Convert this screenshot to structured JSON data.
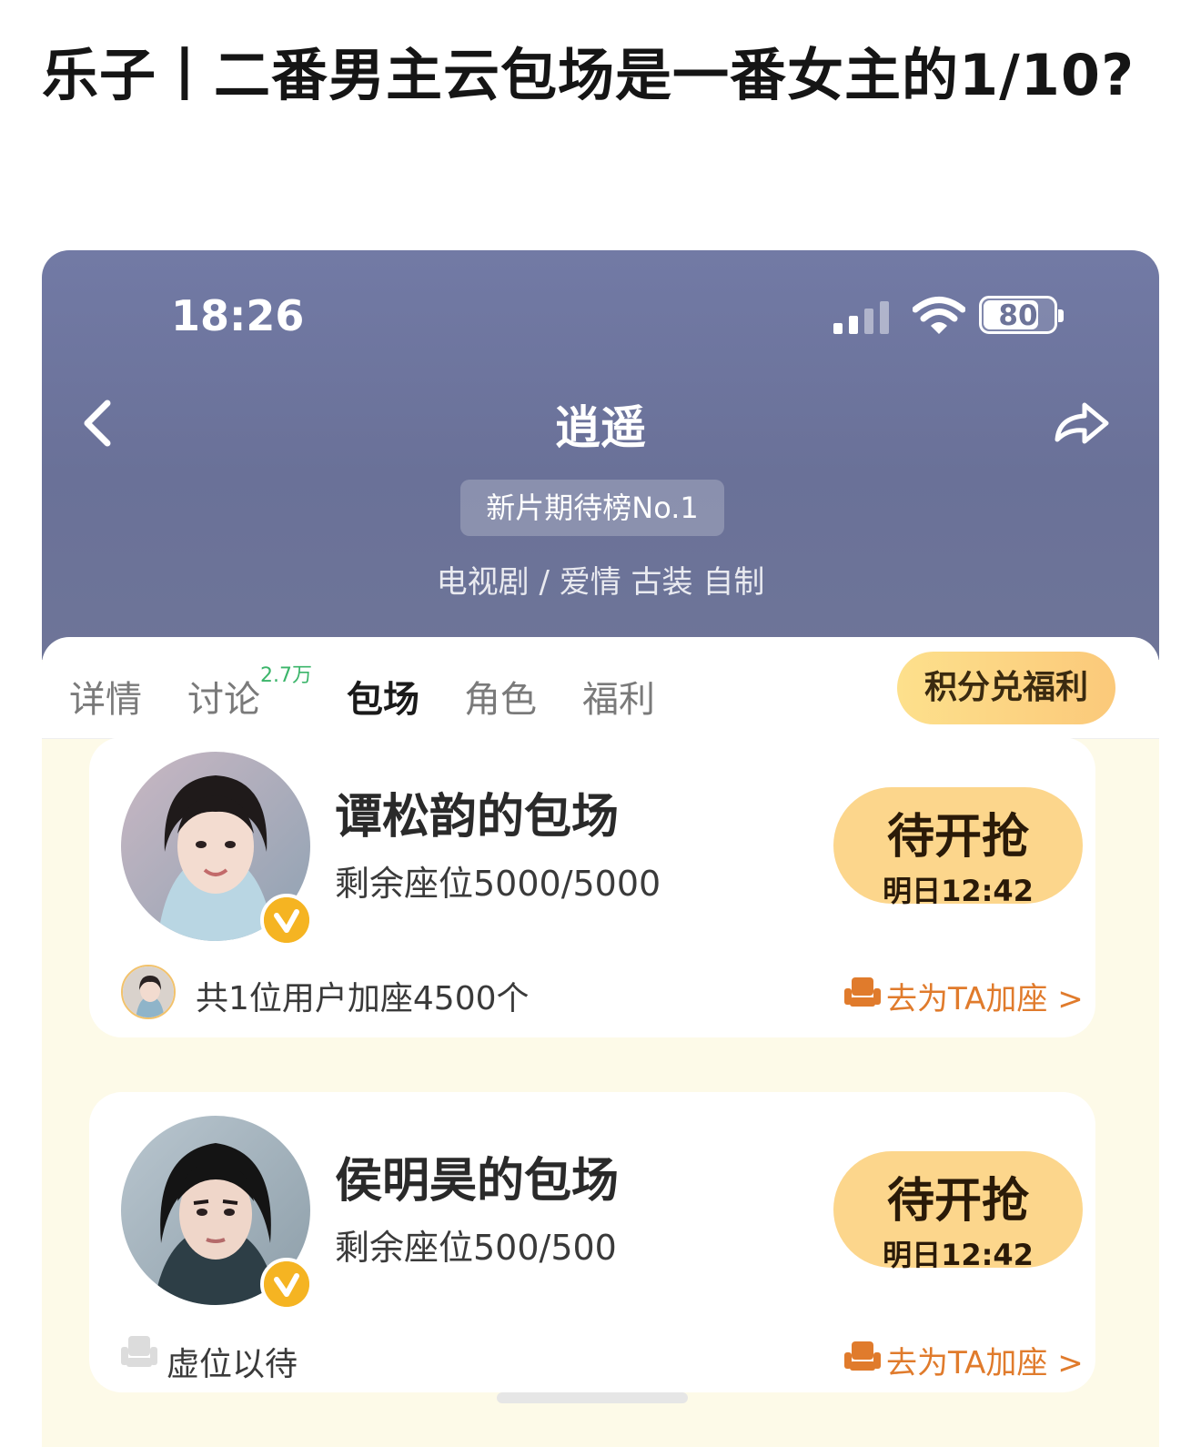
{
  "post": {
    "title": "乐子丨二番男主云包场是一番女主的1/10?"
  },
  "status_bar": {
    "time": "18:26",
    "battery": "80",
    "battery_level": 0.8
  },
  "header": {
    "title": "逍遥",
    "rank_badge": "新片期待榜No.1",
    "genre": "电视剧 / 爱情 古装 自制"
  },
  "tabs": [
    {
      "label": "详情"
    },
    {
      "label": "讨论",
      "count": "2.7万"
    },
    {
      "label": "包场",
      "active": true
    },
    {
      "label": "角色"
    },
    {
      "label": "福利"
    }
  ],
  "points_button": "积分兑福利",
  "cards": [
    {
      "title": "谭松韵的包场",
      "seats": "剩余座位5000/5000",
      "button_label": "待开抢",
      "button_time": "明日12:42",
      "footer_text": "共1位用户加座4500个",
      "link": "去为TA加座 >"
    },
    {
      "title": "侯明昊的包场",
      "seats": "剩余座位500/500",
      "button_label": "待开抢",
      "button_time": "明日12:42",
      "footer_text": "虚位以待",
      "link": "去为TA加座 >"
    }
  ],
  "colors": {
    "header": "#6e7598",
    "accent": "#e07b2c",
    "button": "#fcd68c",
    "count": "#3bb56a"
  },
  "icons": [
    "chevron-left-icon",
    "share-icon",
    "signal-icon",
    "wifi-icon",
    "battery-icon",
    "verified-icon",
    "seat-icon"
  ]
}
